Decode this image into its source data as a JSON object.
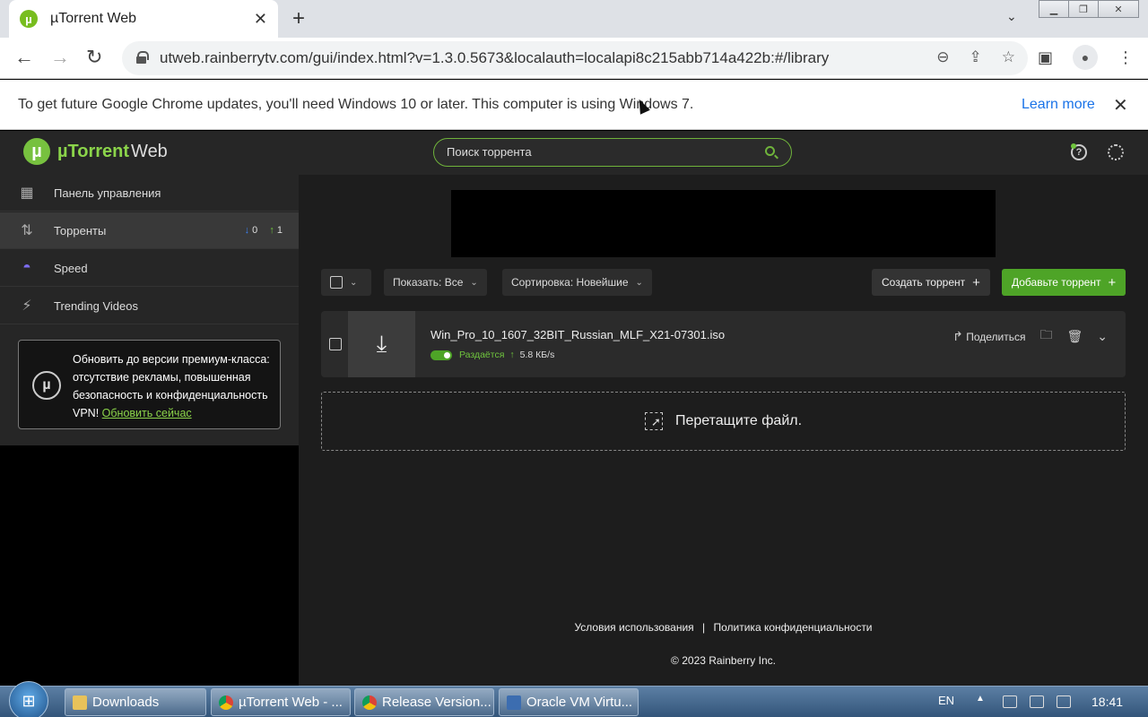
{
  "browser": {
    "tab_title": "µTorrent Web",
    "tab_close": "✕",
    "new_tab": "+",
    "url": "utweb.rainberrytv.com/gui/index.html?v=1.3.0.5673&localauth=localapi8c215abb714a422b:#/library",
    "infobar_text": "To get future Google Chrome updates, you'll need Windows 10 or later. This computer is using Windows 7.",
    "infobar_link": "Learn more",
    "infobar_close": "✕"
  },
  "app": {
    "logo_brand": "µTorrent",
    "logo_suffix": "Web",
    "search_placeholder": "Поиск торрента",
    "help_label": "?",
    "accent_color": "#4ea427"
  },
  "sidebar": {
    "items": [
      {
        "label": "Панель управления",
        "icon": "dashboard-icon"
      },
      {
        "label": "Торренты",
        "icon": "transfer-arrows-icon",
        "down_count": "0",
        "up_count": "1"
      },
      {
        "label": "Speed",
        "icon": "speedometer-icon"
      },
      {
        "label": "Trending Videos",
        "icon": "lightning-icon"
      }
    ],
    "promo": {
      "text": "Обновить до версии премиум-класса: отсутствие рекламы, повышенная безопасность и конфиденциальность VPN!",
      "link": "Обновить сейчас"
    }
  },
  "toolbar": {
    "show_label": "Показать:",
    "show_value": "Все",
    "sort_label": "Сортировка:",
    "sort_value": "Новейшие",
    "create_button": "Создать торрент",
    "add_button": "Добавьте торрент"
  },
  "torrents": [
    {
      "name": "Win_Pro_10_1607_32BIT_Russian_MLF_X21-07301.iso",
      "status": "Раздаётся",
      "upload_speed": "5.8 КБ/s",
      "share_label": "Поделиться"
    }
  ],
  "dropzone": {
    "text": "Перетащите файл."
  },
  "footer": {
    "terms": "Условия использования",
    "separator": "|",
    "privacy": "Политика конфиденциальности",
    "copyright": "© 2023 Rainberry Inc."
  },
  "taskbar": {
    "items": [
      {
        "label": "Downloads",
        "icon": "folder-icon"
      },
      {
        "label": "µTorrent Web - ...",
        "icon": "chrome-icon"
      },
      {
        "label": "Release Version...",
        "icon": "chrome-icon"
      },
      {
        "label": "Oracle VM Virtu...",
        "icon": "virtualbox-icon"
      }
    ],
    "language": "EN",
    "clock": "18:41"
  }
}
